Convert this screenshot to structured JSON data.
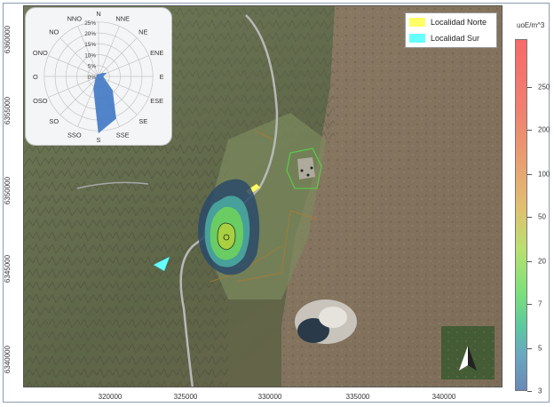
{
  "legend": {
    "items": [
      {
        "label": "Localidad Norte",
        "color": "#ffff66"
      },
      {
        "label": "Localidad Sur",
        "color": "#66ffff"
      }
    ]
  },
  "colorbar": {
    "title": "uoE/m^3",
    "ticks": [
      "250",
      "200",
      "100",
      "50",
      "20",
      "7",
      "5",
      "3"
    ]
  },
  "axes": {
    "x_ticks": [
      "320000",
      "325000",
      "330000",
      "335000",
      "340000"
    ],
    "y_ticks": [
      "6360000",
      "6355000",
      "6350000",
      "6345000",
      "6340000"
    ]
  },
  "wind_rose": {
    "directions": [
      "N",
      "NNE",
      "NE",
      "ENE",
      "E",
      "ESE",
      "SE",
      "SSE",
      "S",
      "SSO",
      "SO",
      "OSO",
      "O",
      "ONO",
      "NO",
      "NNO"
    ],
    "ring_labels": [
      "25%",
      "20%",
      "15%",
      "10%",
      "5%",
      "0%"
    ],
    "frequencies": [
      0.01,
      0.01,
      0.02,
      0.04,
      0.02,
      0.03,
      0.09,
      0.21,
      0.26,
      0.06,
      0.02,
      0.01,
      0.01,
      0.01,
      0.01,
      0.01
    ]
  },
  "colors": {
    "plume_outer": "#2a4a6a",
    "plume_mid": "#4aa8a0",
    "plume_inner": "#6cd060",
    "plume_core": "#a8d040",
    "rose_fill": "#4a7ec8"
  }
}
